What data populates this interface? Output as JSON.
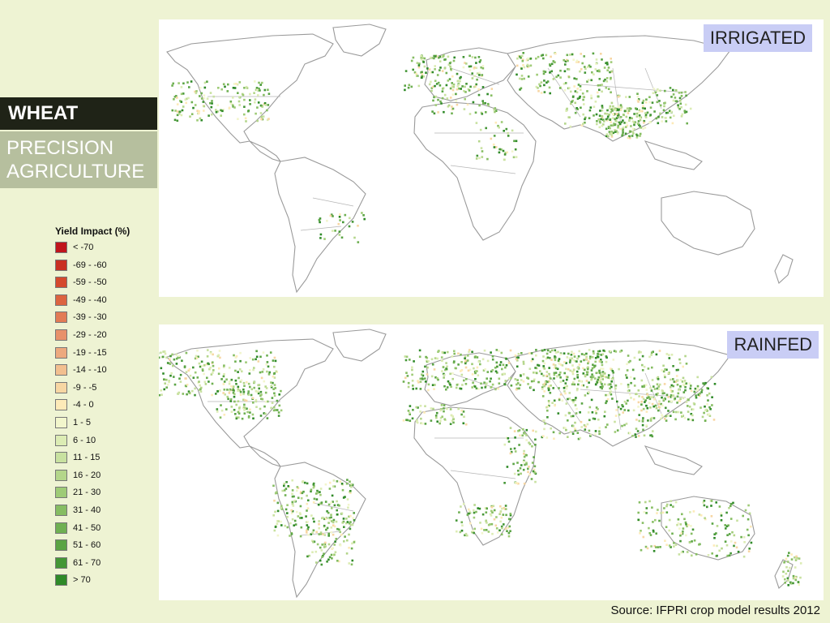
{
  "crop_title": "WHEAT",
  "scenario_title": "PRECISION\nAGRICULTURE",
  "maps": [
    {
      "label": "IRRIGATED"
    },
    {
      "label": "RAINFED"
    }
  ],
  "legend": {
    "title": "Yield Impact (%)",
    "items": [
      {
        "label": "< -70",
        "color": "#c0141c"
      },
      {
        "label": "-69 - -60",
        "color": "#c92f22"
      },
      {
        "label": "-59 - -50",
        "color": "#d4492e"
      },
      {
        "label": "-49 - -40",
        "color": "#dc6440"
      },
      {
        "label": "-39 - -30",
        "color": "#e27b55"
      },
      {
        "label": "-29 - -20",
        "color": "#e8916a"
      },
      {
        "label": "-19 - -15",
        "color": "#eda97e"
      },
      {
        "label": "-14 - -10",
        "color": "#f2bf8f"
      },
      {
        "label": "-9 - -5",
        "color": "#f7d6a3"
      },
      {
        "label": "-4 - 0",
        "color": "#fdeab8"
      },
      {
        "label": "1 - 5",
        "color": "#f2f6cc"
      },
      {
        "label": "6 - 10",
        "color": "#dcecb4"
      },
      {
        "label": "11 - 15",
        "color": "#c8e1a0"
      },
      {
        "label": "16 - 20",
        "color": "#b4d68a"
      },
      {
        "label": "21 - 30",
        "color": "#9ecb76"
      },
      {
        "label": "31 - 40",
        "color": "#86bd62"
      },
      {
        "label": "41 - 50",
        "color": "#6fb052"
      },
      {
        "label": "51 - 60",
        "color": "#5aa444"
      },
      {
        "label": "61 - 70",
        "color": "#449636"
      },
      {
        "label": "> 70",
        "color": "#2f8a28"
      }
    ]
  },
  "source_note": "Source: IFPRI crop model results 2012"
}
